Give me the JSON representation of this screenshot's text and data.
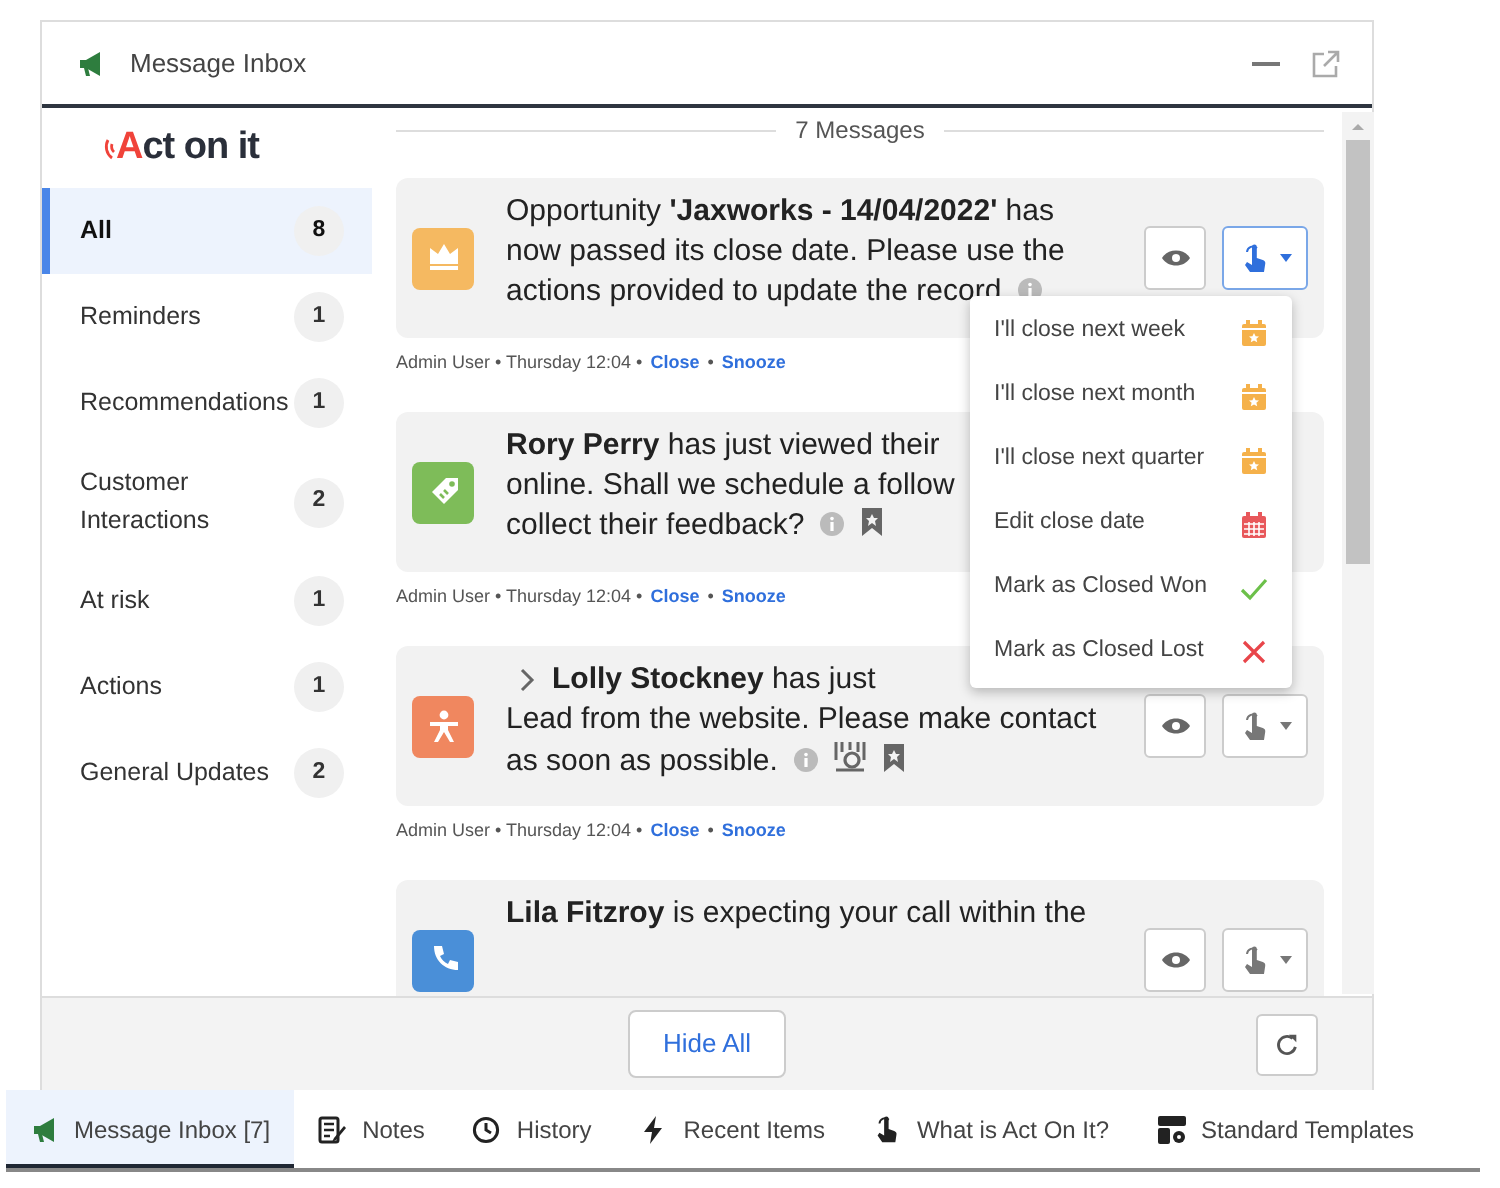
{
  "window": {
    "title": "Message Inbox"
  },
  "logo": {
    "text": "Act on it"
  },
  "sidebar": {
    "items": [
      {
        "label": "All",
        "count": "8",
        "selected": true
      },
      {
        "label": "Reminders",
        "count": "1",
        "selected": false
      },
      {
        "label": "Recommendations",
        "count": "1",
        "selected": false
      },
      {
        "label": "Customer Interactions",
        "count": "2",
        "selected": false
      },
      {
        "label": "At risk",
        "count": "1",
        "selected": false
      },
      {
        "label": "Actions",
        "count": "1",
        "selected": false
      },
      {
        "label": "General Updates",
        "count": "2",
        "selected": false
      }
    ]
  },
  "heading": "7 Messages",
  "messages": [
    {
      "kind": "crown",
      "color": "#f5b961",
      "lines": [
        "Opportunity **'Jaxworks - 14/04/2022'** has",
        "now passed its close date. Please use the",
        "actions provided to update the record"
      ],
      "badges": [
        {
          "kind": "info"
        }
      ],
      "menu_open": true,
      "meta": "Admin User • Thursday 12:04 •",
      "close": "Close",
      "sep": "•",
      "snooze": "Snooze"
    },
    {
      "kind": "tag",
      "color": "#7ebc59",
      "lines": [
        "**Rory Perry** has just viewed their",
        "online. Shall we schedule a follow",
        "collect their feedback?"
      ],
      "badges": [
        {
          "kind": "info"
        },
        {
          "kind": "bookmark"
        }
      ],
      "meta": "Admin User • Thursday 12:04 •",
      "close": "Close",
      "sep": "•",
      "snooze": "Snooze"
    },
    {
      "kind": "person",
      "color": "#f0875f",
      "expandable": true,
      "lines": [
        "**Lolly Stockney** has just",
        "Lead from the website. Please make contact",
        "as soon as possible."
      ],
      "badges": [
        {
          "kind": "info"
        },
        {
          "kind": "meeting"
        },
        {
          "kind": "bookmark"
        }
      ],
      "menu_open": false,
      "meta": "Admin User • Thursday 12:04 •",
      "close": "Close",
      "sep": "•",
      "snooze": "Snooze"
    },
    {
      "kind": "phone",
      "color": "#4a8fd8",
      "lines": [
        "**Lila Fitzroy** is expecting your call within the"
      ],
      "menu_open": false
    }
  ],
  "menu": [
    {
      "label": "I'll close next week",
      "kind": "calendar-star",
      "color": "#f5b14a"
    },
    {
      "label": "I'll close next month",
      "kind": "calendar-star",
      "color": "#f5b14a"
    },
    {
      "label": "I'll close next quarter",
      "kind": "calendar-star",
      "color": "#f5b14a"
    },
    {
      "label": "Edit close date",
      "kind": "calendar",
      "color": "#e8585b"
    },
    {
      "label": "Mark as Closed Won",
      "kind": "check",
      "color": "#6cc04a"
    },
    {
      "label": "Mark as Closed Lost",
      "kind": "cross",
      "color": "#e8454a"
    }
  ],
  "footer": {
    "button": "Hide All"
  },
  "tabs": [
    {
      "label": "Message Inbox [7]",
      "kind": "megaphone",
      "selected": true
    },
    {
      "label": "Notes",
      "kind": "notes",
      "selected": false
    },
    {
      "label": "History",
      "kind": "clock",
      "selected": false
    },
    {
      "label": "Recent Items",
      "kind": "bolt",
      "selected": false
    },
    {
      "label": "What is Act On It?",
      "kind": "hand",
      "selected": false
    },
    {
      "label": "Standard Templates",
      "kind": "templates",
      "selected": false
    }
  ]
}
